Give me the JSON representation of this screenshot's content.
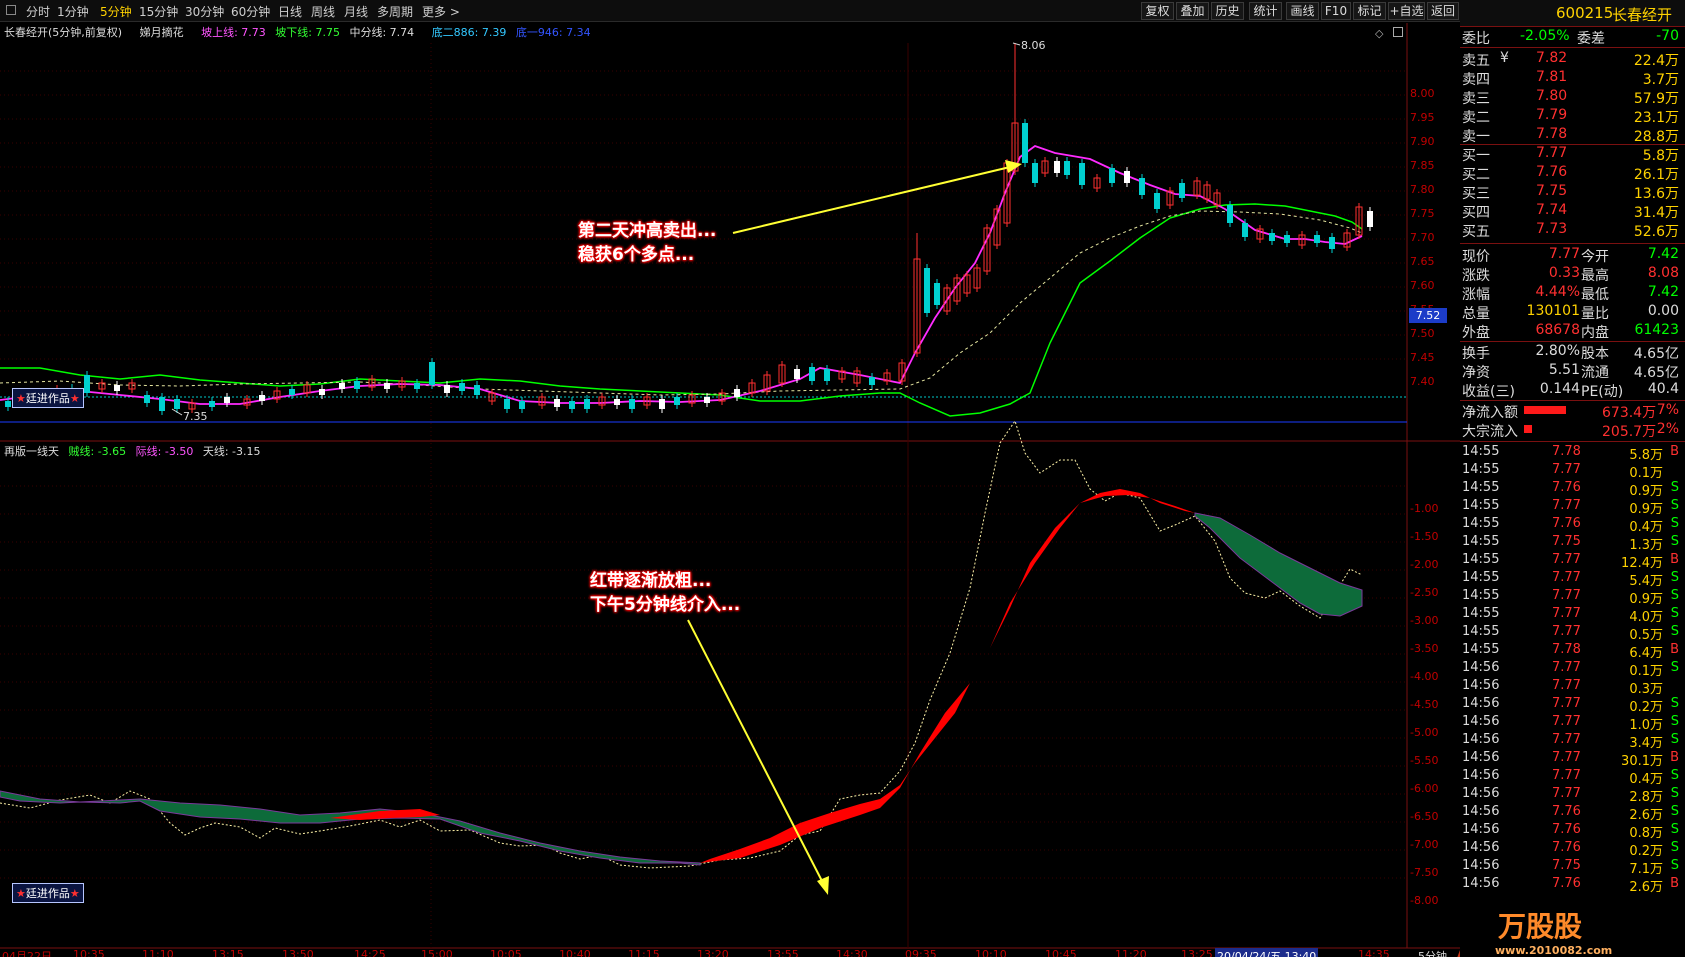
{
  "toolbar": {
    "timeframes": [
      "分时",
      "1分钟",
      "5分钟",
      "15分钟",
      "30分钟",
      "60分钟",
      "日线",
      "周线",
      "月线",
      "多周期",
      "更多 >"
    ],
    "active_index": 2,
    "buttons": [
      "复权",
      "叠加",
      "历史",
      "统计",
      "画线",
      "F10",
      "标记",
      "+自选",
      "返回"
    ]
  },
  "stock": {
    "code": "600215",
    "name": "长春经开"
  },
  "main_legend": {
    "title": "长春经开(5分钟,前复权)",
    "indicator": "娣月摘花",
    "upper": "坡上线: 7.73",
    "lower": "坡下线: 7.75",
    "mid": "中分线: 7.74",
    "bottom2": "底二886: 7.39",
    "bottom1": "底一946: 7.34"
  },
  "sub_legend": {
    "title": "再版一线天",
    "l1": "贼线: -3.65",
    "l2": "际线: -3.50",
    "l3": "天线: -3.15"
  },
  "main_axis": [
    "8.00",
    "7.95",
    "7.90",
    "7.85",
    "7.80",
    "7.75",
    "7.70",
    "7.65",
    "7.60",
    "7.55",
    "7.50",
    "7.45",
    "7.40"
  ],
  "current_price_tag": "7.52",
  "high_label": "8.06",
  "low_label": "7.35",
  "sub_axis": [
    "-1.00",
    "-1.50",
    "-2.00",
    "-2.50",
    "-3.00",
    "-3.50",
    "-4.00",
    "-4.50",
    "-5.00",
    "-5.50",
    "-6.00",
    "-6.50",
    "-7.00",
    "-7.50",
    "-8.00"
  ],
  "time_axis": [
    "04月22日",
    "10:35",
    "11:10",
    "13:15",
    "13:50",
    "14:25",
    "15:00",
    "10:05",
    "10:40",
    "11:15",
    "13:20",
    "13:55",
    "14:30",
    "09:35",
    "10:10",
    "10:45",
    "11:20",
    "13:25",
    "20/04/24/五 13:40",
    "14:35",
    "5分钟"
  ],
  "stamps": [
    "廷进作品",
    "廷进作品"
  ],
  "annotations": {
    "top": [
      "第二天冲高卖出...",
      "稳获6个多点..."
    ],
    "bottom": [
      "红带逐渐放粗...",
      "下午5分钟线介入..."
    ]
  },
  "ratio": {
    "label1": "委比",
    "v1": "-2.05%",
    "label2": "委差",
    "v2": "-70"
  },
  "orderbook": [
    {
      "label": "卖五",
      "price": "7.82",
      "vol": "22.4万",
      "mark": "¥"
    },
    {
      "label": "卖四",
      "price": "7.81",
      "vol": "3.7万",
      "mark": ""
    },
    {
      "label": "卖三",
      "price": "7.80",
      "vol": "57.9万",
      "mark": ""
    },
    {
      "label": "卖二",
      "price": "7.79",
      "vol": "23.1万",
      "mark": ""
    },
    {
      "label": "卖一",
      "price": "7.78",
      "vol": "28.8万",
      "mark": ""
    },
    {
      "label": "买一",
      "price": "7.77",
      "vol": "5.8万",
      "mark": ""
    },
    {
      "label": "买二",
      "price": "7.76",
      "vol": "26.1万",
      "mark": ""
    },
    {
      "label": "买三",
      "price": "7.75",
      "vol": "13.6万",
      "mark": ""
    },
    {
      "label": "买四",
      "price": "7.74",
      "vol": "31.4万",
      "mark": ""
    },
    {
      "label": "买五",
      "price": "7.73",
      "vol": "52.6万",
      "mark": ""
    }
  ],
  "quote": [
    {
      "l1": "现价",
      "v1": "7.77",
      "c1": "#ff3030",
      "l2": "今开",
      "v2": "7.42",
      "c2": "#00ff00"
    },
    {
      "l1": "涨跌",
      "v1": "0.33",
      "c1": "#ff3030",
      "l2": "最高",
      "v2": "8.08",
      "c2": "#ff3030"
    },
    {
      "l1": "涨幅",
      "v1": "4.44%",
      "c1": "#ff3030",
      "l2": "最低",
      "v2": "7.42",
      "c2": "#00ff00"
    },
    {
      "l1": "总量",
      "v1": "130101",
      "c1": "#ffd200",
      "l2": "量比",
      "v2": "0.00",
      "c2": "#dcdcdc"
    },
    {
      "l1": "外盘",
      "v1": "68678",
      "c1": "#ff3030",
      "l2": "内盘",
      "v2": "61423",
      "c2": "#00ff00"
    }
  ],
  "finance": [
    {
      "l1": "换手",
      "v1": "2.80%",
      "l2": "股本",
      "v2": "4.65亿"
    },
    {
      "l1": "净资",
      "v1": "5.51",
      "l2": "流通",
      "v2": "4.65亿"
    },
    {
      "l1": "收益(三)",
      "v1": "0.144",
      "l2": "PE(动)",
      "v2": "40.4"
    }
  ],
  "flows": [
    {
      "label": "净流入额",
      "value": "673.4万",
      "pct": "7%",
      "bar": 0.75
    },
    {
      "label": "大宗流入",
      "value": "205.7万",
      "pct": "2%",
      "bar": 0.15
    }
  ],
  "ticks": [
    {
      "t": "14:55",
      "p": "7.78",
      "v": "5.8万",
      "d": "B"
    },
    {
      "t": "14:55",
      "p": "7.77",
      "v": "0.1万",
      "d": ""
    },
    {
      "t": "14:55",
      "p": "7.76",
      "v": "0.9万",
      "d": "S"
    },
    {
      "t": "14:55",
      "p": "7.77",
      "v": "0.9万",
      "d": "S"
    },
    {
      "t": "14:55",
      "p": "7.76",
      "v": "0.4万",
      "d": "S"
    },
    {
      "t": "14:55",
      "p": "7.75",
      "v": "1.3万",
      "d": "S"
    },
    {
      "t": "14:55",
      "p": "7.77",
      "v": "12.4万",
      "d": "B"
    },
    {
      "t": "14:55",
      "p": "7.77",
      "v": "5.4万",
      "d": "S"
    },
    {
      "t": "14:55",
      "p": "7.77",
      "v": "0.9万",
      "d": "S"
    },
    {
      "t": "14:55",
      "p": "7.77",
      "v": "4.0万",
      "d": "S"
    },
    {
      "t": "14:55",
      "p": "7.77",
      "v": "0.5万",
      "d": "S"
    },
    {
      "t": "14:55",
      "p": "7.78",
      "v": "6.4万",
      "d": "B"
    },
    {
      "t": "14:56",
      "p": "7.77",
      "v": "0.1万",
      "d": "S"
    },
    {
      "t": "14:56",
      "p": "7.77",
      "v": "0.3万",
      "d": ""
    },
    {
      "t": "14:56",
      "p": "7.77",
      "v": "0.2万",
      "d": "S"
    },
    {
      "t": "14:56",
      "p": "7.77",
      "v": "1.0万",
      "d": "S"
    },
    {
      "t": "14:56",
      "p": "7.77",
      "v": "3.4万",
      "d": "S"
    },
    {
      "t": "14:56",
      "p": "7.77",
      "v": "30.1万",
      "d": "B"
    },
    {
      "t": "14:56",
      "p": "7.77",
      "v": "0.4万",
      "d": "S"
    },
    {
      "t": "14:56",
      "p": "7.77",
      "v": "2.8万",
      "d": "S"
    },
    {
      "t": "14:56",
      "p": "7.76",
      "v": "2.6万",
      "d": "S"
    },
    {
      "t": "14:56",
      "p": "7.76",
      "v": "0.8万",
      "d": "S"
    },
    {
      "t": "14:56",
      "p": "7.76",
      "v": "0.2万",
      "d": "S"
    },
    {
      "t": "14:56",
      "p": "7.75",
      "v": "7.1万",
      "d": "S"
    },
    {
      "t": "14:56",
      "p": "7.76",
      "v": "2.6万",
      "d": "B"
    }
  ],
  "watermark": {
    "brand": "万股股",
    "url": "www.2010082.com"
  },
  "colors": {
    "red": "#ff0000",
    "green": "#00ff00",
    "magenta": "#ff00ff",
    "yellow": "#ffd200",
    "cyan": "#00ffff",
    "accent_border": "#7a1010"
  }
}
